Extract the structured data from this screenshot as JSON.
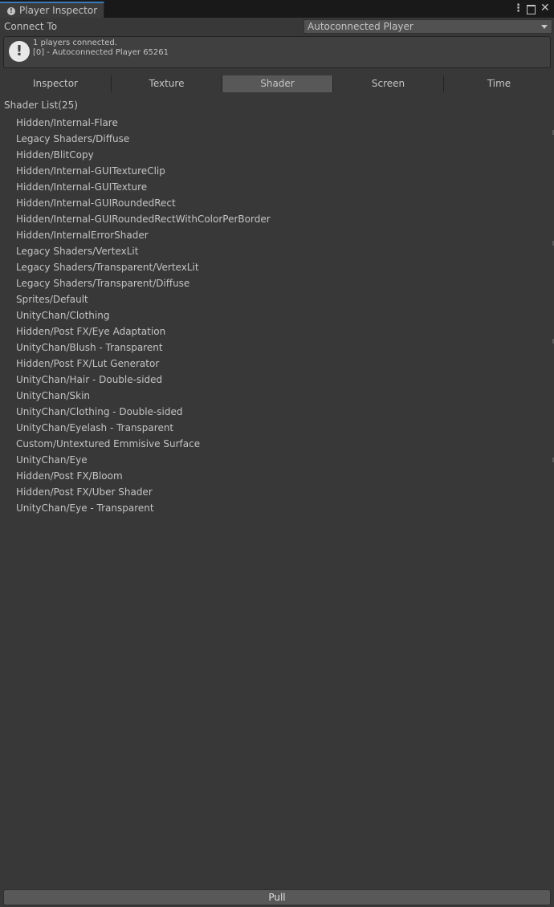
{
  "window": {
    "tab_title": "Player Inspector",
    "tab_icon": "info-icon",
    "controls": [
      "menu-icon",
      "maximize-icon",
      "close-icon"
    ]
  },
  "connect": {
    "label": "Connect To",
    "selected": "Autoconnected Player"
  },
  "info": {
    "icon": "exclamation-icon",
    "line1": "1 players connected.",
    "line2": "[0] - Autoconnected Player 65261"
  },
  "toolbar": {
    "tabs": [
      "Inspector",
      "Texture",
      "Shader",
      "Screen",
      "Time"
    ],
    "active": "Shader"
  },
  "shader_list": {
    "title": "Shader List(25)",
    "items": [
      "Hidden/Internal-Flare",
      "Legacy Shaders/Diffuse",
      "Hidden/BlitCopy",
      "Hidden/Internal-GUITextureClip",
      "Hidden/Internal-GUITexture",
      "Hidden/Internal-GUIRoundedRect",
      "Hidden/Internal-GUIRoundedRectWithColorPerBorder",
      "Hidden/InternalErrorShader",
      "Legacy Shaders/VertexLit",
      "Legacy Shaders/Transparent/VertexLit",
      "Legacy Shaders/Transparent/Diffuse",
      "Sprites/Default",
      "UnityChan/Clothing",
      "Hidden/Post FX/Eye Adaptation",
      "UnityChan/Blush - Transparent",
      "Hidden/Post FX/Lut Generator",
      "UnityChan/Hair - Double-sided",
      "UnityChan/Skin",
      "UnityChan/Clothing - Double-sided",
      "UnityChan/Eyelash - Transparent",
      "Custom/Untextured Emmisive Surface",
      "UnityChan/Eye",
      "Hidden/Post FX/Bloom",
      "Hidden/Post FX/Uber Shader",
      "UnityChan/Eye - Transparent"
    ]
  },
  "pull_button": {
    "label": "Pull"
  },
  "colors": {
    "background": "#383838",
    "active_tab": "#585858",
    "tab_accent": "#3a79bb",
    "text": "#c4c4c4"
  }
}
